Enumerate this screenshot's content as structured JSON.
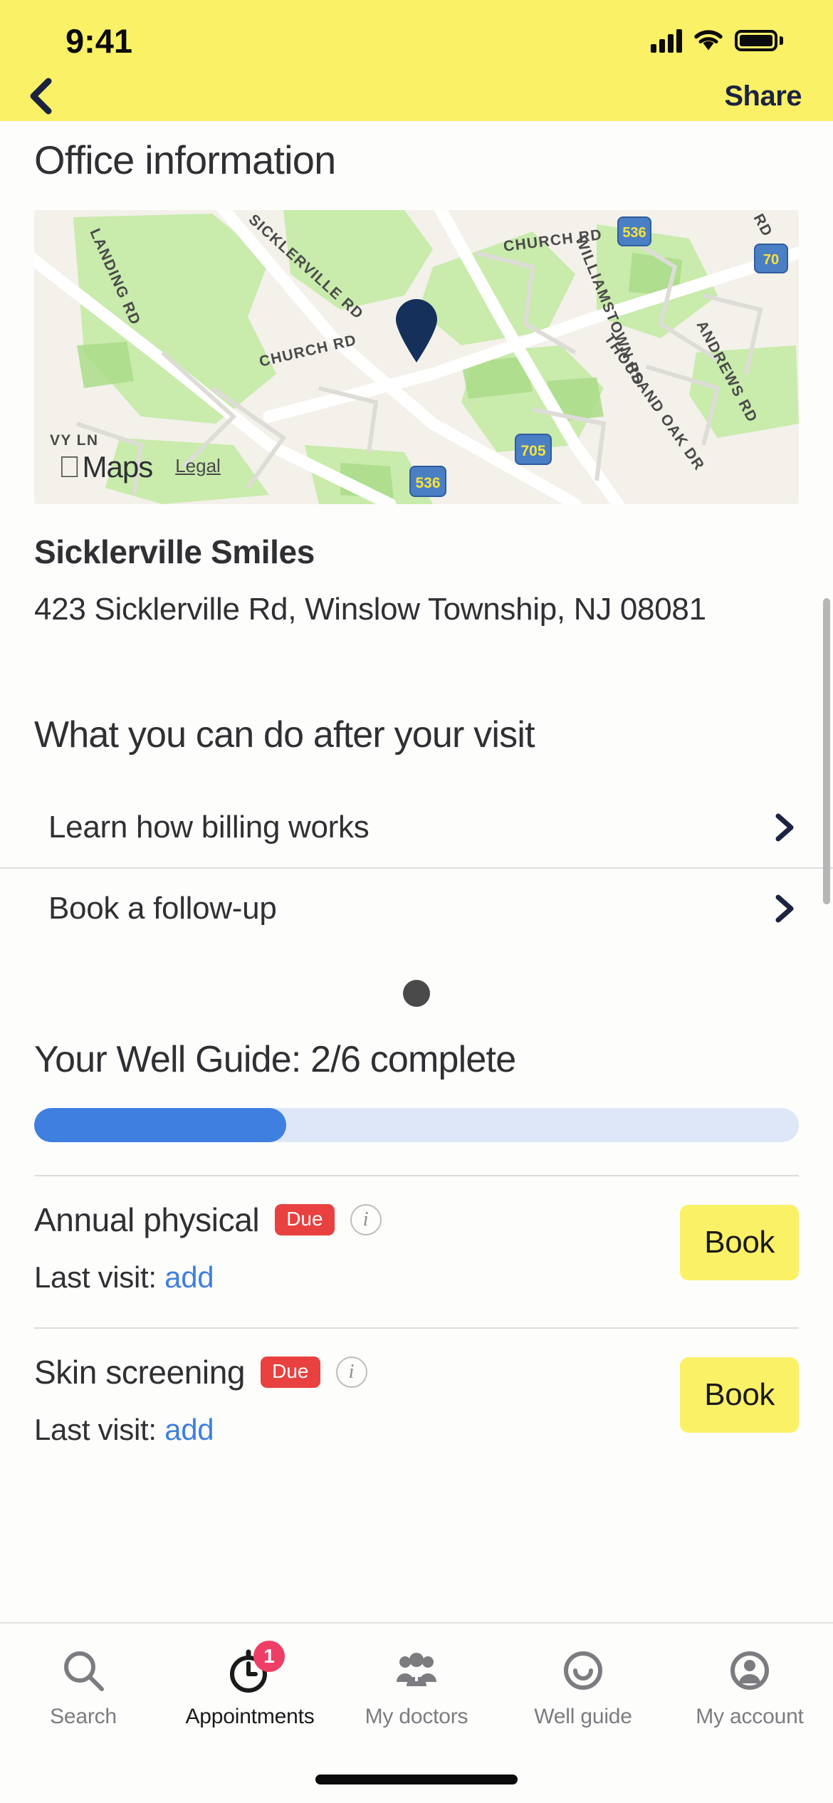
{
  "status_bar": {
    "time": "9:41",
    "cellular_icon": "signal-bars-icon",
    "wifi_icon": "wifi-icon",
    "battery_icon": "battery-icon"
  },
  "nav_bar": {
    "back_icon": "chevron-left-icon",
    "share_label": "Share",
    "background_color": "#FBF167"
  },
  "page": {
    "title": "Office information"
  },
  "map": {
    "provider_label": "Maps",
    "apple_logo": "apple-logo-icon",
    "legal_label": "Legal",
    "pin_icon": "map-pin-icon",
    "pin_color": "#16305c",
    "road_labels": [
      "LANDING RD",
      "VY LN",
      "CHURCH RD",
      "CHURCH RD",
      "SICKLERVILLE RD",
      "WILLIAMSTOWN RD",
      "THOUSAND OAK DR",
      "ANDREWS RD",
      "RD"
    ],
    "route_shields": [
      "536",
      "705",
      "536",
      "70"
    ]
  },
  "office": {
    "name": "Sicklerville Smiles",
    "address": "423 Sicklerville Rd, Winslow Township, NJ 08081"
  },
  "after_visit": {
    "title": "What you can do after your visit",
    "items": [
      {
        "label": "Learn how billing works",
        "chevron_icon": "chevron-right-icon"
      },
      {
        "label": "Book a follow-up",
        "chevron_icon": "chevron-right-icon"
      }
    ],
    "carousel_dot": "carousel-dot"
  },
  "well_guide": {
    "title": "Your Well Guide: 2/6 complete",
    "progress_percent": 33,
    "progress_fill_color": "#3f7fe0",
    "progress_track_color": "#dee7f8",
    "items": [
      {
        "name": "Annual physical",
        "badge": "Due",
        "badge_color": "#e8413f",
        "info_icon": "info-icon",
        "last_visit_prefix": "Last visit:",
        "last_visit_action": "add",
        "action_label": "Book"
      },
      {
        "name": "Skin screening",
        "badge": "Due",
        "badge_color": "#e8413f",
        "info_icon": "info-icon",
        "last_visit_prefix": "Last visit:",
        "last_visit_action": "add",
        "action_label": "Book"
      }
    ]
  },
  "tab_bar": {
    "tabs": [
      {
        "label": "Search",
        "icon": "search-icon",
        "active": false,
        "badge": ""
      },
      {
        "label": "Appointments",
        "icon": "clock-icon",
        "active": true,
        "badge": "1"
      },
      {
        "label": "My doctors",
        "icon": "people-group-icon",
        "active": false,
        "badge": ""
      },
      {
        "label": "Well guide",
        "icon": "smiley-icon",
        "active": false,
        "badge": ""
      },
      {
        "label": "My account",
        "icon": "account-icon",
        "active": false,
        "badge": ""
      }
    ]
  }
}
